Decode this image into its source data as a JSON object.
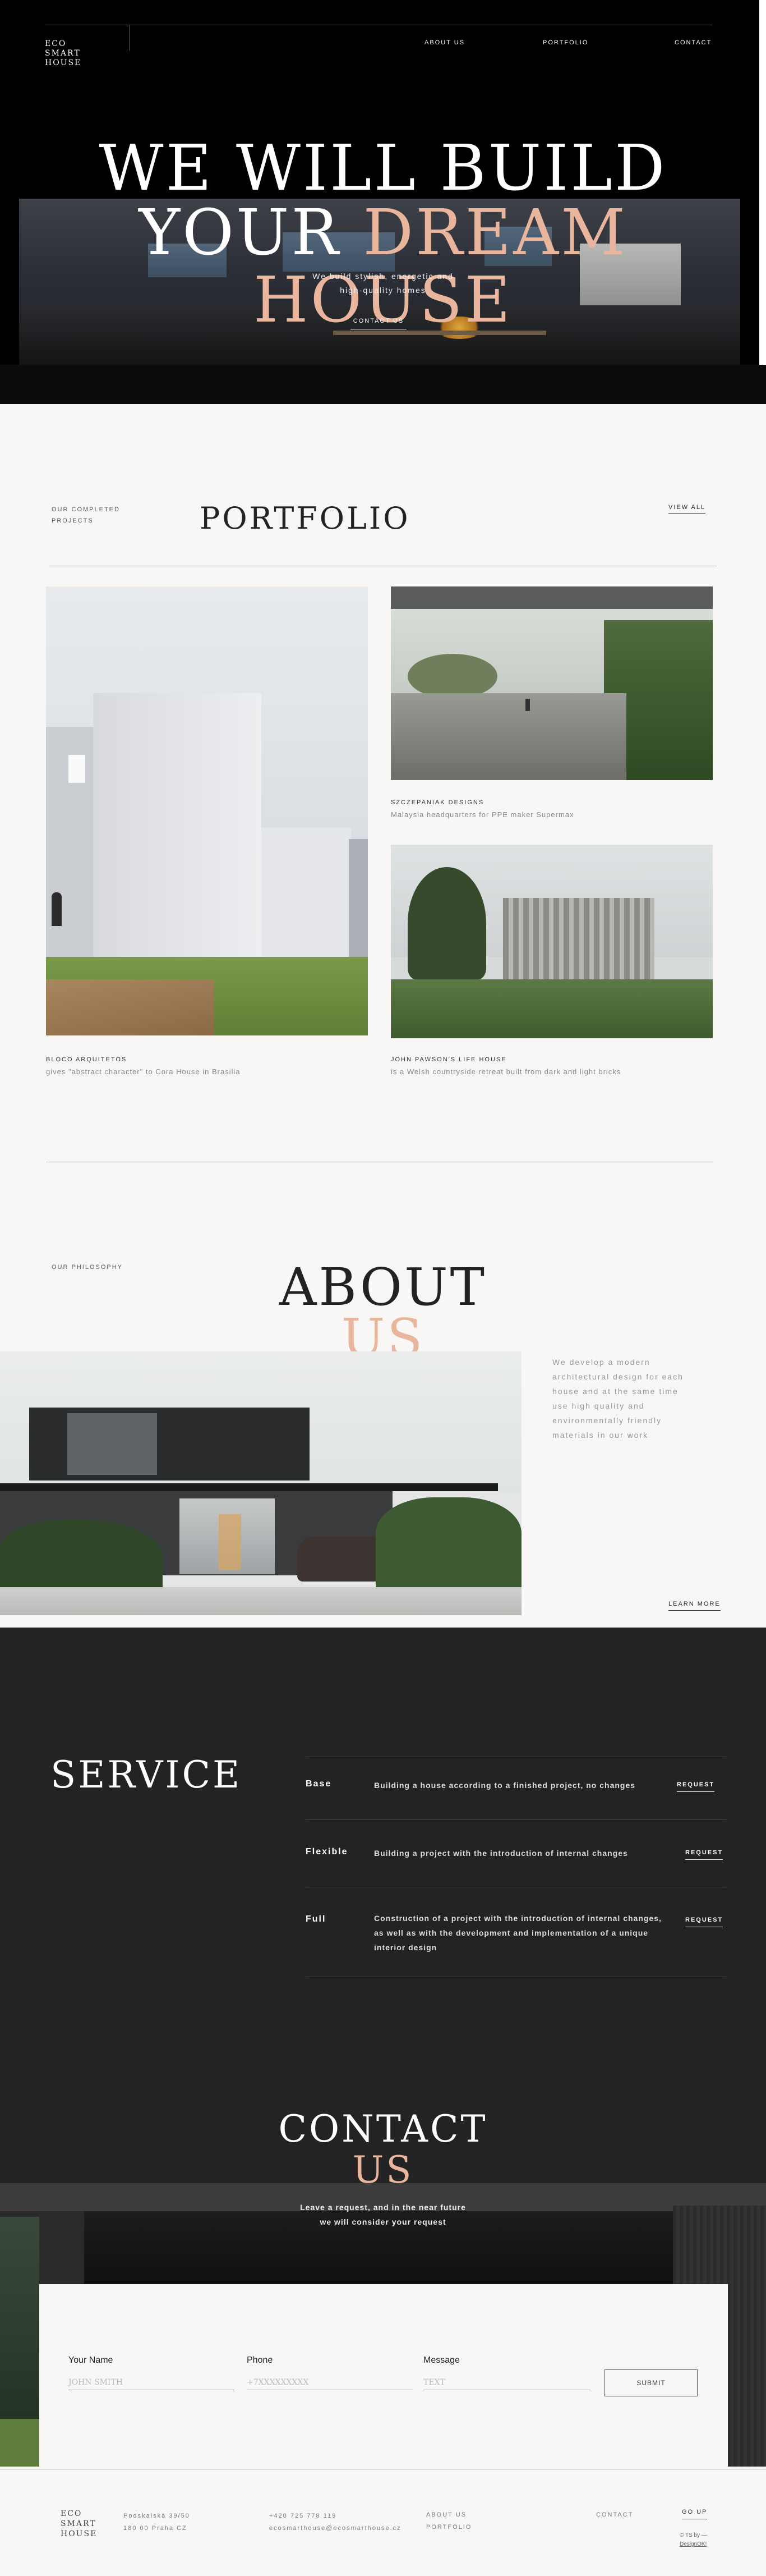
{
  "brand": {
    "logo_lines": [
      "ECO",
      "SMART",
      "HOUSE"
    ]
  },
  "nav": {
    "about": "ABOUT US",
    "portfolio": "PORTFOLIO",
    "contact": "CONTACT"
  },
  "hero": {
    "title_line1": "WE WILL BUILD",
    "title_line2_a": "YOUR ",
    "title_line2_b": "DREAM HOUSE",
    "subtitle_line1": "We build stylish, energetic and",
    "subtitle_line2": "high-quality homes",
    "cta": "CONTACT US"
  },
  "portfolio": {
    "eyebrow_line1": "OUR COMPLETED",
    "eyebrow_line2": "PROJECTS",
    "title": "PORTFOLIO",
    "view_all": "VIEW ALL",
    "projects": [
      {
        "title": "BLOCO ARQUITETOS",
        "subtitle": "gives \"abstract character\" to Cora House in Brasilia"
      },
      {
        "title": "SZCZEPANIAK DESIGNS",
        "subtitle": "Malaysia headquarters for PPE maker Supermax"
      },
      {
        "title": "JOHN PAWSON'S LIFE HOUSE",
        "subtitle": "is a Welsh countryside retreat built from dark and light bricks"
      }
    ]
  },
  "about": {
    "eyebrow": "OUR PHILOSOPHY",
    "title_line1": "ABOUT",
    "title_line2": "US",
    "text_lines": [
      "We develop a modern",
      "architectural design for each",
      "house and at the same time",
      "use high quality and",
      "environmentally friendly",
      "materials in our work"
    ],
    "learn_more": "LEARN MORE"
  },
  "service": {
    "title": "SERVICE",
    "rows": [
      {
        "name": "Base",
        "desc_lines": [
          "Building a house according to a finished project, no changes"
        ],
        "button": "REQUEST"
      },
      {
        "name": "Flexible",
        "desc_lines": [
          "Building a project with the introduction of internal changes"
        ],
        "button": "REQUEST"
      },
      {
        "name": "Full",
        "desc_lines": [
          "Construction of a project with the introduction of internal changes,",
          "as well as with the development and implementation of a unique",
          "interior design"
        ],
        "button": "REQUEST"
      }
    ]
  },
  "contact": {
    "title_line1": "CONTACT",
    "title_line2": "US",
    "subtitle_line1": "Leave a request, and in the near future",
    "subtitle_line2": "we will consider your request",
    "fields": [
      {
        "label": "Your Name",
        "placeholder": "JOHN SMITH"
      },
      {
        "label": "Phone",
        "placeholder": "+7XXXXXXXXX"
      },
      {
        "label": "Message",
        "placeholder": "TEXT"
      }
    ],
    "submit": "SUBMIT"
  },
  "footer": {
    "address_line1": "Podskalská 39/50",
    "address_line2": "180 00 Praha CZ",
    "phone": "+420 725 778 119",
    "email": "ecosmarthouse@ecosmarthouse.cz",
    "links": {
      "about": "ABOUT US",
      "portfolio": "PORTFOLIO",
      "contact": "CONTACT"
    },
    "go_up": "GO UP",
    "credit_line1": "© TS by —",
    "credit_line2": "DesignOK!"
  },
  "colors": {
    "accent_peach": "#e9b69d",
    "dark_bg": "#232323",
    "light_bg": "#f8f7f5"
  }
}
